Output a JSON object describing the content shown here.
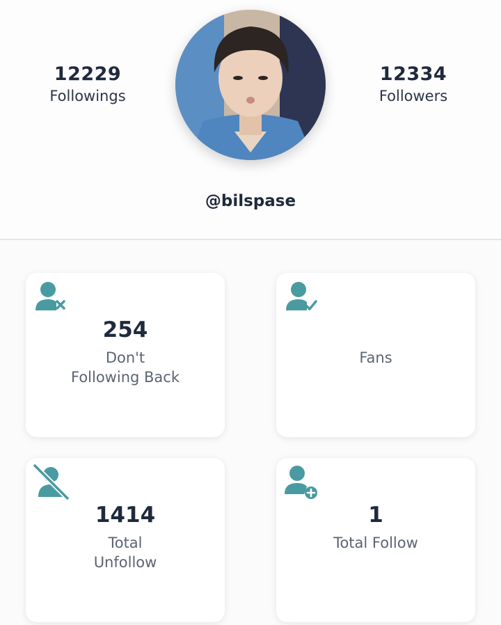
{
  "profile": {
    "followings_count": "12229",
    "followings_label": "Followings",
    "followers_count": "12334",
    "followers_label": "Followers",
    "username": "@bilspase"
  },
  "cards": [
    {
      "icon": "user-x-icon",
      "value": "254",
      "label_line1": "Don't",
      "label_line2": "Following Back"
    },
    {
      "icon": "user-check-icon",
      "value": "",
      "label_line1": "Fans",
      "label_line2": ""
    },
    {
      "icon": "user-slash-icon",
      "value": "1414",
      "label_line1": "Total",
      "label_line2": "Unfollow"
    },
    {
      "icon": "user-plus-icon",
      "value": "1",
      "label_line1": "Total Follow",
      "label_line2": ""
    }
  ],
  "colors": {
    "accent": "#4a9aa1",
    "text_dark": "#1f2a3c",
    "text_muted": "#5b6472"
  }
}
